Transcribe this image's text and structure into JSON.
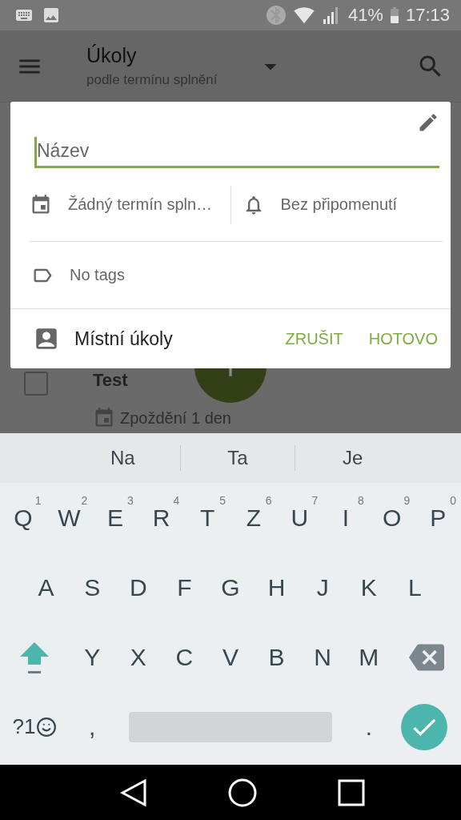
{
  "status_bar": {
    "battery": "41%",
    "time": "17:13"
  },
  "app_bar": {
    "title": "Úkoly",
    "subtitle": "podle termínu splnění"
  },
  "task": {
    "title": "Test",
    "due": "Zpoždění 1 den",
    "checked": false
  },
  "dialog": {
    "name_field": {
      "placeholder": "Název"
    },
    "due_date": "Žádný termín spln…",
    "reminder": "Bez připomenutí",
    "tags": "No tags",
    "list": "Místní úkoly",
    "buttons": [
      "ZRUŠIT",
      "HOTOVO"
    ]
  },
  "keyboard": {
    "suggestions": [
      "Na",
      "Ta",
      "Je"
    ],
    "rows": [
      {
        "keys": [
          {
            "kind": "letter",
            "label": "Q",
            "hint": "1"
          },
          {
            "kind": "letter",
            "label": "W",
            "hint": "2"
          },
          {
            "kind": "letter",
            "label": "E",
            "hint": "3"
          },
          {
            "kind": "letter",
            "label": "R",
            "hint": "4"
          },
          {
            "kind": "letter",
            "label": "T",
            "hint": "5"
          },
          {
            "kind": "letter",
            "label": "Z",
            "hint": "6"
          },
          {
            "kind": "letter",
            "label": "U",
            "hint": "7"
          },
          {
            "kind": "letter",
            "label": "I",
            "hint": "8"
          },
          {
            "kind": "letter",
            "label": "O",
            "hint": "9"
          },
          {
            "kind": "letter",
            "label": "P",
            "hint": "0"
          }
        ]
      },
      {
        "keys": [
          {
            "kind": "letter",
            "label": "A"
          },
          {
            "kind": "letter",
            "label": "S"
          },
          {
            "kind": "letter",
            "label": "D"
          },
          {
            "kind": "letter",
            "label": "F"
          },
          {
            "kind": "letter",
            "label": "G"
          },
          {
            "kind": "letter",
            "label": "H"
          },
          {
            "kind": "letter",
            "label": "J"
          },
          {
            "kind": "letter",
            "label": "K"
          },
          {
            "kind": "letter",
            "label": "L"
          }
        ]
      },
      {
        "keys": [
          {
            "kind": "shift",
            "on": true
          },
          {
            "kind": "letter",
            "label": "Y"
          },
          {
            "kind": "letter",
            "label": "X"
          },
          {
            "kind": "letter",
            "label": "C"
          },
          {
            "kind": "letter",
            "label": "V"
          },
          {
            "kind": "letter",
            "label": "B"
          },
          {
            "kind": "letter",
            "label": "N"
          },
          {
            "kind": "letter",
            "label": "M"
          },
          {
            "kind": "backspace"
          }
        ]
      },
      {
        "keys": [
          {
            "kind": "symbols",
            "label": "?1"
          },
          {
            "kind": "letter",
            "label": ","
          },
          {
            "kind": "space"
          },
          {
            "kind": "letter",
            "label": "."
          },
          {
            "kind": "enter"
          }
        ]
      }
    ]
  }
}
